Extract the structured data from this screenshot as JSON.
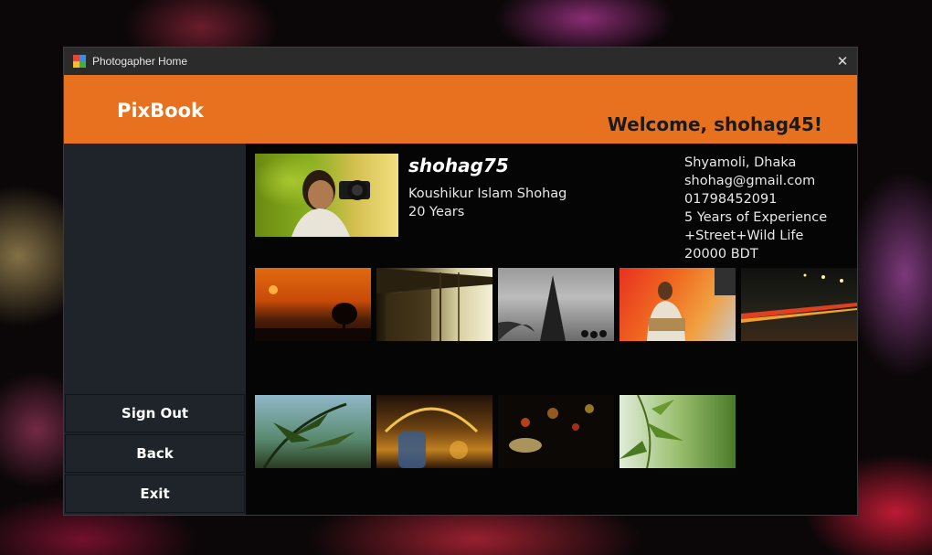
{
  "window": {
    "title": "Photogapher Home",
    "close_symbol": "✕"
  },
  "header": {
    "logo": "PixBook",
    "welcome": "Welcome, shohag45!",
    "color": "#e8711f"
  },
  "sidebar": {
    "buttons": [
      "Sign Out",
      "Back",
      "Exit"
    ]
  },
  "profile": {
    "username": "shohag75",
    "full_name": "Koushikur Islam Shohag",
    "age": "20 Years",
    "location": "Shyamoli, Dhaka",
    "email": "shohag@gmail.com",
    "phone": "01798452091",
    "experience": "5 Years of Experience",
    "specialty": "+Street+Wild Life",
    "rate": "20000 BDT"
  },
  "gallery": {
    "photos": [
      "sunset-tree-photo",
      "bridge-photo",
      "monument-photo",
      "street-vendor-photo",
      "night-traffic-photo",
      "bamboo-leaves-photo",
      "bottle-bokeh-photo",
      "night-bokeh-photo",
      "green-leaves-photo"
    ]
  }
}
